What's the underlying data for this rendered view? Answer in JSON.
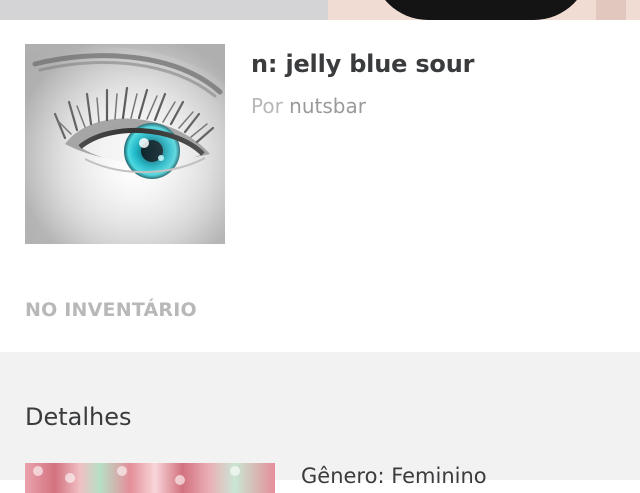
{
  "item": {
    "title": "n: jelly blue sour",
    "by_label": "Por",
    "creator": "nutsbar",
    "inventory_status": "NO INVENTÁRIO"
  },
  "details": {
    "heading": "Detalhes",
    "genre": "Gênero: Feminino"
  },
  "colors": {
    "text_dark": "#393b3d",
    "text_muted": "#b8b8b8",
    "panel_bg": "#f2f2f2",
    "eye_iris": "#1fb8c8"
  },
  "icons": {
    "thumbnail": "eye-makeup-thumbnail",
    "preview": "floral-preview-image"
  }
}
